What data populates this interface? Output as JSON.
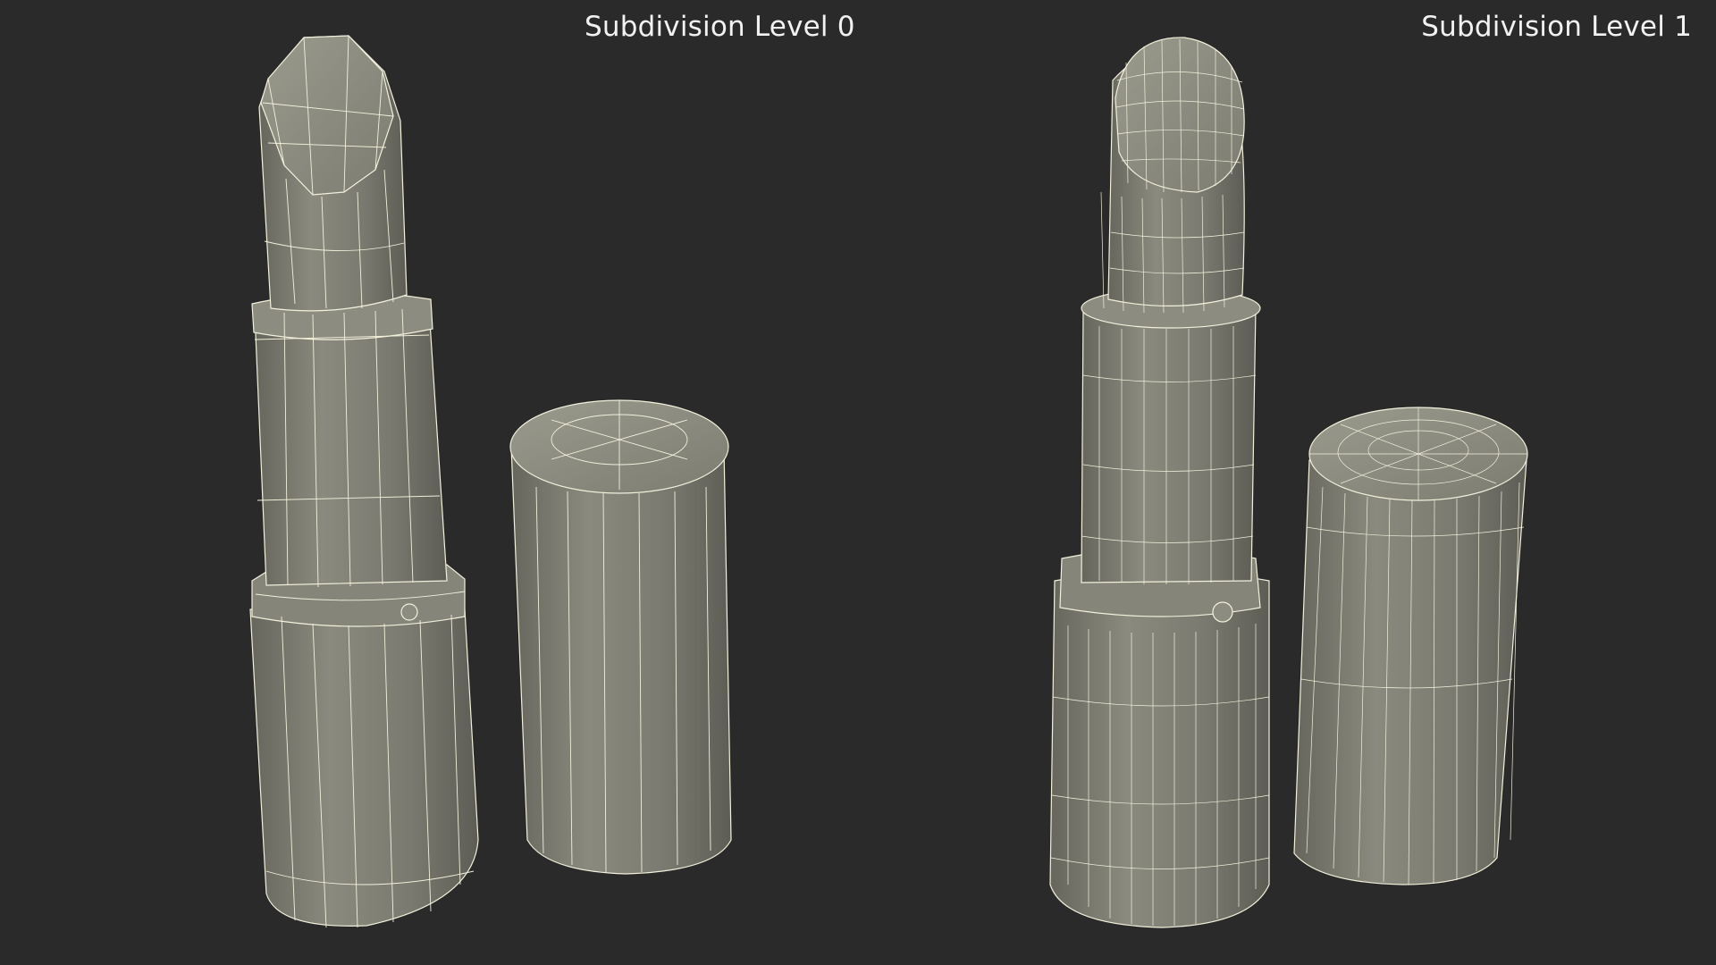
{
  "labels": {
    "left": "Subdivision Level 0",
    "right": "Subdivision Level 1"
  },
  "colors": {
    "background": "#2a2a2a",
    "surface": "#7a7a6f",
    "surface_light": "#8c8c80",
    "surface_dark": "#5f5f57",
    "wire": "#f3f1dc",
    "text": "#f2f2f2"
  },
  "icons": {
    "left_group": "lipstick-model-icon",
    "right_group": "lipstick-model-icon"
  }
}
